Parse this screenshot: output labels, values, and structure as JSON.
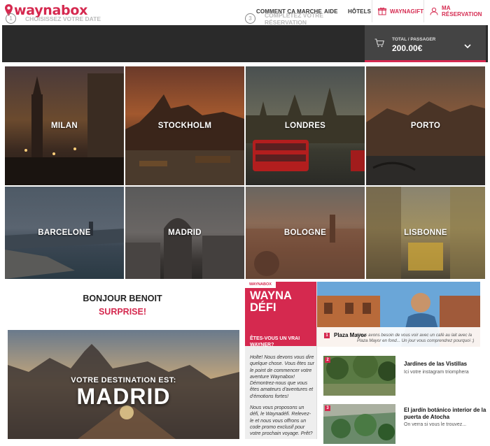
{
  "header": {
    "logo_text": "waynabox",
    "nav": {
      "how_it_works": "COMMENT ÇA MARCHE",
      "help": "AIDE",
      "hotels": "HÔTELS",
      "gift": "WAYNAGIFT",
      "my_booking": "MA RÉSERVATION"
    }
  },
  "steps": [
    {
      "num": "1",
      "label": "CHOISISSEZ VOTRE DATE"
    },
    {
      "num": "2",
      "label": "ÉLIMINEZ LES DESTINATIONS"
    },
    {
      "num": "3",
      "label": "COMPLÉTEZ VOTRE RÉSERVATION"
    }
  ],
  "total": {
    "label": "TOTAL / PASSAGER",
    "amount": "200.00€"
  },
  "destinations": [
    "MILAN",
    "STOCKHOLM",
    "LONDRES",
    "PORTO",
    "BARCELONE",
    "MADRID",
    "BOLOGNE",
    "LISBONNE"
  ],
  "welcome": {
    "greeting": "BONJOUR BENOIT",
    "surprise": "SURPRISE!"
  },
  "result": {
    "line1": "VOTRE DESTINATION EST:",
    "city": "MADRID"
  },
  "defi": {
    "brand": "WAYNABOX",
    "title_line1": "WAYNA",
    "title_line2": "DÉFI",
    "question": "ÊTES-VOUS UN VRAI WAYNER?",
    "para1": "Holte! Nous devons vous dire quelque chose. Vous êtes sur le point de commencer votre aventure Waynabox! Démontrez-nous que vous êtes amateurs d'aventures et d'émotions fortes!",
    "para2": "Nous vous proposons un défi, le Waynadéfi. Relevez-le et nous vous offrons un code promo exclusif pour votre prochain voyage. Prêt?"
  },
  "places": [
    {
      "num": "1",
      "name": "Plaza Mayor",
      "desc": "Nous avons besoin de vous voir avec un café au lait avec la Plaza Mayor en fond... Un jour vous comprendrez pourquoi :)"
    },
    {
      "num": "2",
      "name": "Jardines de las Vistillas",
      "desc": "Ici votre instagram triomphera"
    },
    {
      "num": "3",
      "name": "El jardín botánico interior de la puerta de Atocha",
      "desc": "On verra si vous le trouvez..."
    }
  ],
  "colors": {
    "accent": "#d5294f",
    "dark_bar": "#2a2a2a"
  }
}
